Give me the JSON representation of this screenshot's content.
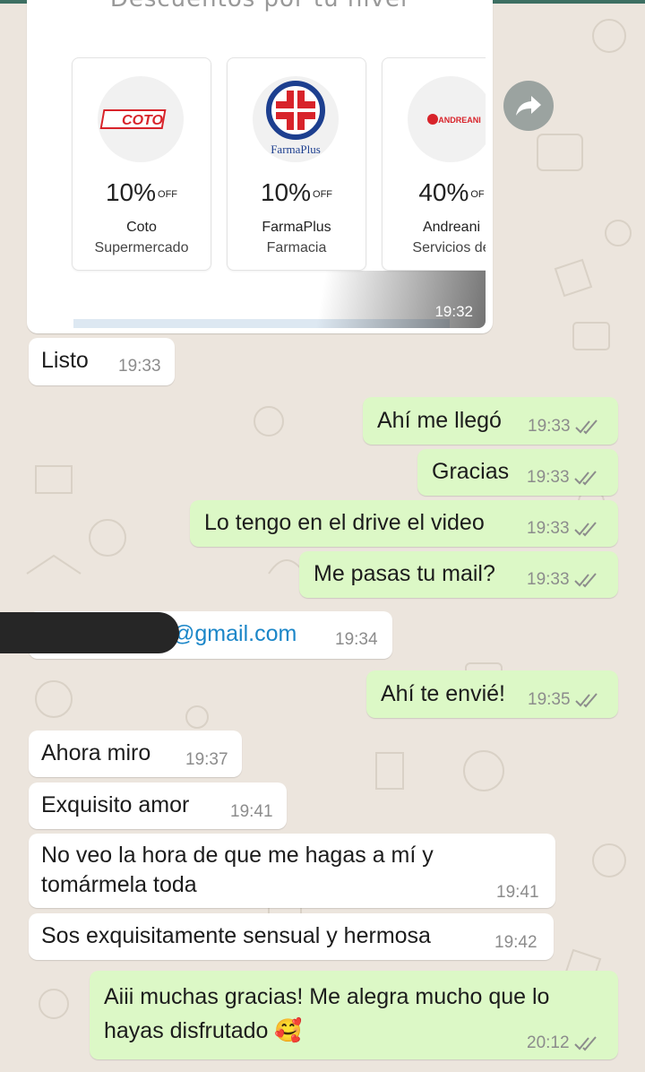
{
  "image_message": {
    "heading": "Descuentos por tu nivel",
    "time": "19:32",
    "stores": [
      {
        "logo_text": "COTO",
        "discount": "10%",
        "off": "OFF",
        "name": "Coto",
        "category": "Supermercado"
      },
      {
        "logo_text": "FarmaPlus",
        "discount": "10%",
        "off": "OFF",
        "name": "FarmaPlus",
        "category": "Farmacia"
      },
      {
        "logo_text": "ANDREANI",
        "discount": "40%",
        "off": "OF",
        "name": "Andreani",
        "category": "Servicios de"
      }
    ]
  },
  "messages": [
    {
      "dir": "in",
      "text": "Listo",
      "time": "19:33"
    },
    {
      "dir": "out",
      "text": "Ahí me llegó",
      "time": "19:33"
    },
    {
      "dir": "out",
      "text": "Gracias",
      "time": "19:33"
    },
    {
      "dir": "out",
      "text": "Lo tengo en el drive el video",
      "time": "19:33"
    },
    {
      "dir": "out",
      "text": "Me pasas tu mail?",
      "time": "19:33"
    },
    {
      "dir": "in",
      "text": "@gmail.com",
      "time": "19:34"
    },
    {
      "dir": "out",
      "text": "Ahí te envié!",
      "time": "19:35"
    },
    {
      "dir": "in",
      "text": "Ahora miro",
      "time": "19:37"
    },
    {
      "dir": "in",
      "text": "Exquisito amor",
      "time": "19:41"
    },
    {
      "dir": "in",
      "text": "No veo la hora de que me hagas a mí y tomármela toda",
      "time": "19:41"
    },
    {
      "dir": "in",
      "text": "Sos exquisitamente sensual y hermosa",
      "time": "19:42"
    },
    {
      "dir": "out",
      "text": "Aiii muchas gracias! Me alegra mucho que lo hayas disfrutado 🥰",
      "time": "20:12"
    }
  ],
  "icons": {
    "share": "forward-icon",
    "read_receipt": "double-check-icon"
  },
  "colors": {
    "incoming": "#ffffff",
    "outgoing": "#dcf8c6",
    "wallpaper": "#ece5dd",
    "link": "#1b86c8"
  }
}
